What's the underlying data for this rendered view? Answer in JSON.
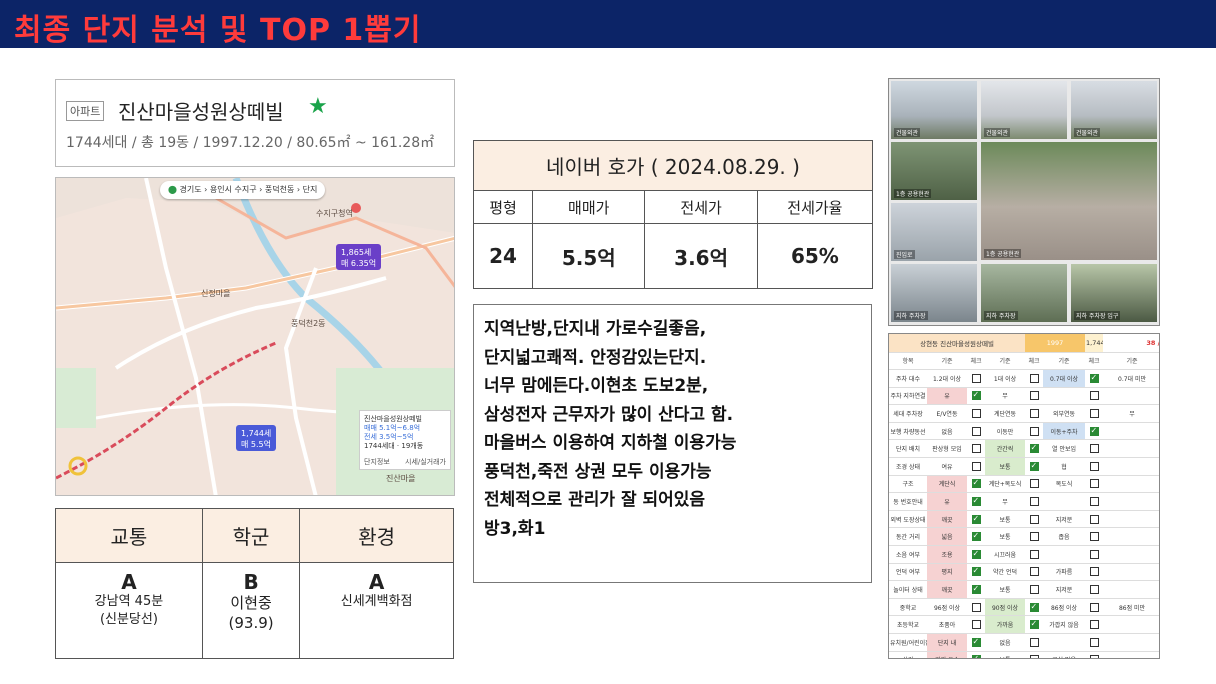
{
  "header": {
    "title": "최종 단지 분석 및 TOP 1뽑기"
  },
  "apartment": {
    "tag": "아파트",
    "name": "진산마을성원상떼빌",
    "star": "★",
    "meta": "1744세대 / 총 19동 / 1997.12.20 / 80.65㎡ ~ 161.28㎡"
  },
  "map": {
    "pill": {
      "region": "경기도",
      "city": "용인시 수지구",
      "dong": "풍덕천동",
      "more": "단지"
    },
    "markers": [
      {
        "line1": "1,865세",
        "line2": "매 6.35억"
      },
      {
        "line1": "1,744세",
        "line2": "매 5.5억"
      }
    ],
    "labels": [
      "신정마을",
      "풍덕천2동",
      "수지구청역",
      "진산마을"
    ],
    "popup": {
      "title": "진산마을성원상떼빌",
      "sale": "매매 5.1억~6.8억",
      "jeonse": "전세 3.5억~5억",
      "info": "1744세대 · 19개동",
      "tab1": "단지정보",
      "tab2": "시세/실거래가"
    }
  },
  "grades": {
    "headers": [
      "교통",
      "학군",
      "환경"
    ],
    "cells": [
      {
        "grade": "A",
        "line1": "강남역 45분",
        "line2": "(신분당선)"
      },
      {
        "grade": "B",
        "line1": "이현중",
        "line2": "(93.9)"
      },
      {
        "grade": "A",
        "line1": "신세계백화점",
        "line2": ""
      }
    ]
  },
  "price": {
    "title": "네이버 호가 ( 2024.08.29. )",
    "headers": [
      "평형",
      "매매가",
      "전세가",
      "전세가율"
    ],
    "values": [
      "24",
      "5.5억",
      "3.6억",
      "65%"
    ]
  },
  "notes": [
    "지역난방,단지내 가로수길좋음,",
    "단지넓고쾌적. 안정감있는단지.",
    "너무 맘에든다.이현초 도보2분,",
    "삼성전자 근무자가 많이 산다고 함.",
    "마을버스 이용하여 지하철 이용가능",
    "풍덕천,죽전 상권 모두 이용가능",
    "전체적으로 관리가 잘 되어있음",
    "방3,화1"
  ],
  "photos": {
    "captions": [
      "건물외관",
      "건물외관",
      "건물외관",
      "1층 공용현관",
      "1층 공용현관",
      "진입로",
      "지하 주차장",
      "지하 주차장 입구"
    ]
  },
  "checklist": {
    "top": {
      "title": "상현동 진산마을성원상떼빌",
      "year": "1997",
      "units": "1,744",
      "extra": "38 /"
    },
    "columns": [
      "항목",
      "기준",
      "체크",
      "기준",
      "체크",
      "기준",
      "체크",
      "기준"
    ],
    "rows": [
      {
        "item": "주차 대수",
        "c1": "1.2대 이상",
        "k1": false,
        "c2": "1대 이상",
        "k2": false,
        "c3": "0.7대 이상",
        "k3": true,
        "c4": "0.7대 미만"
      },
      {
        "item": "주차 지하연결",
        "c1": "유",
        "k1": true,
        "c2": "무",
        "k2": false,
        "c3": "",
        "k3": false,
        "c4": ""
      },
      {
        "item": "세대 주차장",
        "c1": "E/V연동",
        "k1": false,
        "c2": "계단연동",
        "k2": false,
        "c3": "외부연동",
        "k3": false,
        "c4": "무"
      },
      {
        "item": "보행 차량동선",
        "c1": "없음",
        "k1": false,
        "c2": "이동만",
        "k2": false,
        "c3": "이동+주차",
        "k3": true,
        "c4": ""
      },
      {
        "item": "단지 배치",
        "c1": "판상형 모임",
        "k1": false,
        "c2": "간간씩",
        "k2": true,
        "c3": "열 안보임",
        "k3": false,
        "c4": ""
      },
      {
        "item": "조경 상태",
        "c1": "여유",
        "k1": false,
        "c2": "보통",
        "k2": true,
        "c3": "협",
        "k3": false,
        "c4": ""
      },
      {
        "item": "구조",
        "c1": "계단식",
        "k1": true,
        "c2": "계단+복도식",
        "k2": false,
        "c3": "복도식",
        "k3": false,
        "c4": ""
      },
      {
        "item": "동 번호안내",
        "c1": "유",
        "k1": true,
        "c2": "무",
        "k2": false,
        "c3": "",
        "k3": false,
        "c4": ""
      },
      {
        "item": "외벽 도장상태",
        "c1": "깨끗",
        "k1": true,
        "c2": "보통",
        "k2": false,
        "c3": "지저분",
        "k3": false,
        "c4": ""
      },
      {
        "item": "동간 거리",
        "c1": "넓음",
        "k1": true,
        "c2": "보통",
        "k2": false,
        "c3": "좁음",
        "k3": false,
        "c4": ""
      },
      {
        "item": "소음 여부",
        "c1": "조용",
        "k1": true,
        "c2": "시끄러움",
        "k2": false,
        "c3": "",
        "k3": false,
        "c4": ""
      },
      {
        "item": "언덕 여부",
        "c1": "평지",
        "k1": true,
        "c2": "약간 언덕",
        "k2": false,
        "c3": "가파름",
        "k3": false,
        "c4": ""
      },
      {
        "item": "놀이터 상태",
        "c1": "깨끗",
        "k1": true,
        "c2": "보통",
        "k2": false,
        "c3": "지저분",
        "k3": false,
        "c4": ""
      },
      {
        "item": "중학교",
        "c1": "96점 이상",
        "k1": false,
        "c2": "90점 이상",
        "k2": true,
        "c3": "86점 이상",
        "k3": false,
        "c4": "86점 미만"
      },
      {
        "item": "초등학교",
        "c1": "초품아",
        "k1": false,
        "c2": "가까움",
        "k2": true,
        "c3": "가깝지 않음",
        "k3": false,
        "c4": ""
      },
      {
        "item": "유치원/어린이집",
        "c1": "단지 내",
        "k1": true,
        "c2": "없음",
        "k2": false,
        "c3": "",
        "k3": false,
        "c4": ""
      },
      {
        "item": "상가",
        "c1": "관리 우수",
        "k1": true,
        "c2": "보통",
        "k2": false,
        "c3": "공실 많음",
        "k3": false,
        "c4": ""
      }
    ]
  }
}
